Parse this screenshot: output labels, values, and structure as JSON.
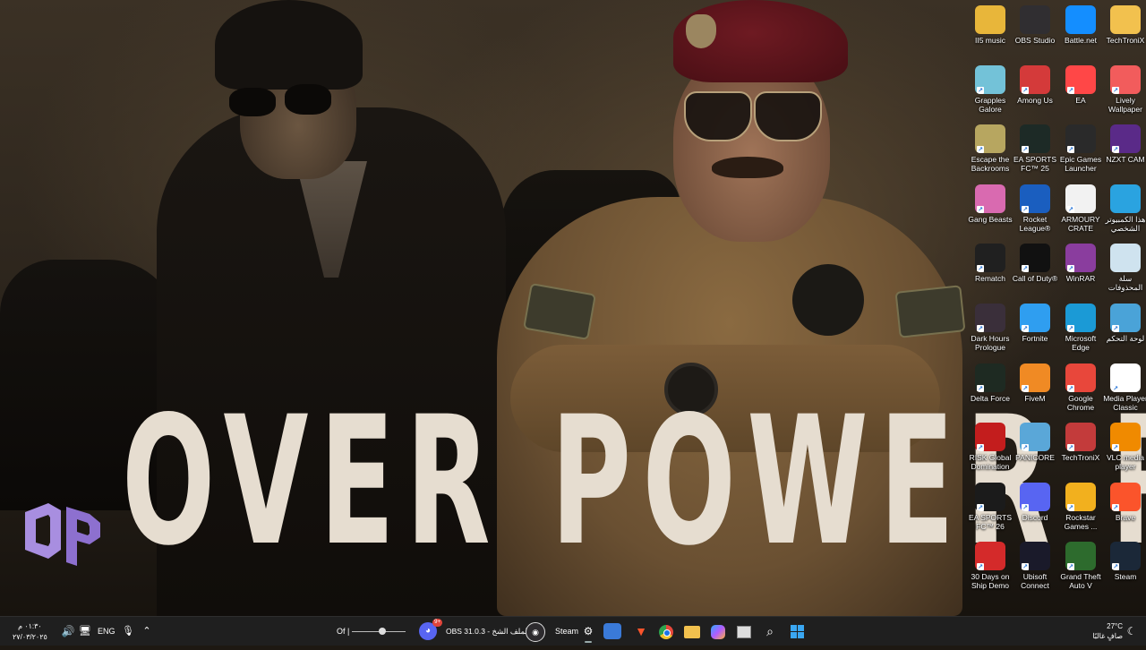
{
  "wallpaper": {
    "title": "OVER POWER RP",
    "logo": "OP-logo",
    "accent": "#9b7fd6"
  },
  "desktop_icons": [
    {
      "label": "II5 music",
      "icon": "folder-icon",
      "color": "#e8b63a"
    },
    {
      "label": "OBS Studio",
      "icon": "obs-icon",
      "color": "#302e31"
    },
    {
      "label": "Battle.net",
      "icon": "battlenet-icon",
      "color": "#148eff"
    },
    {
      "label": "TechTroniX",
      "icon": "folder-icon",
      "color": "#f2c14e"
    },
    {
      "label": "Grapples Galore",
      "icon": "grapples-icon",
      "color": "#73c2d8"
    },
    {
      "label": "Among Us",
      "icon": "among-us-icon",
      "color": "#d43a3a"
    },
    {
      "label": "EA",
      "icon": "ea-icon",
      "color": "#ff4747"
    },
    {
      "label": "Lively Wallpaper",
      "icon": "lively-icon",
      "color": "#f25c5c"
    },
    {
      "label": "Escape the Backrooms",
      "icon": "backrooms-icon",
      "color": "#b7a660"
    },
    {
      "label": "EA SPORTS FC™ 25",
      "icon": "fc25-icon",
      "color": "#1d2a26"
    },
    {
      "label": "Epic Games Launcher",
      "icon": "epic-icon",
      "color": "#2a2a2a"
    },
    {
      "label": "NZXT CAM",
      "icon": "nzxt-icon",
      "color": "#5a2a88"
    },
    {
      "label": "Gang Beasts",
      "icon": "gang-beasts-icon",
      "color": "#d96ab0"
    },
    {
      "label": "Rocket League®",
      "icon": "rocket-league-icon",
      "color": "#1a5ebf"
    },
    {
      "label": "ARMOURY CRATE",
      "icon": "file-icon",
      "color": "#f2f2f2"
    },
    {
      "label": "هذا الكمبيوتر الشخصي",
      "icon": "computer-icon",
      "color": "#2aa3e0"
    },
    {
      "label": "Rematch",
      "icon": "rematch-icon",
      "color": "#202020"
    },
    {
      "label": "Call of Duty®",
      "icon": "cod-icon",
      "color": "#111111"
    },
    {
      "label": "WinRAR",
      "icon": "winrar-icon",
      "color": "#8a3d9e"
    },
    {
      "label": "سلة المحذوفات",
      "icon": "recycle-bin-icon",
      "color": "#cfe3ef"
    },
    {
      "label": "Dark Hours Prologue",
      "icon": "dark-hours-icon",
      "color": "#3a2f3a"
    },
    {
      "label": "Fortnite",
      "icon": "fortnite-icon",
      "color": "#2f9ef0"
    },
    {
      "label": "Microsoft Edge",
      "icon": "edge-icon",
      "color": "#1b9ad6"
    },
    {
      "label": "لوحة التحكم",
      "icon": "control-panel-icon",
      "color": "#4aa3d8"
    },
    {
      "label": "Delta Force",
      "icon": "delta-force-icon",
      "color": "#1e2a22"
    },
    {
      "label": "FiveM",
      "icon": "fivem-icon",
      "color": "#f08a24"
    },
    {
      "label": "Google Chrome",
      "icon": "chrome-icon",
      "color": "#e8473b"
    },
    {
      "label": "Media Player Classic",
      "icon": "mpc-icon",
      "color": "#ffffff"
    },
    {
      "label": "RISK Global Domination",
      "icon": "risk-icon",
      "color": "#c31d1d"
    },
    {
      "label": "PANICORE",
      "icon": "panicore-icon",
      "color": "#5aa7d8"
    },
    {
      "label": "TechTroniX",
      "icon": "techtronix-icon",
      "color": "#c33b3b"
    },
    {
      "label": "VLC media player",
      "icon": "vlc-icon",
      "color": "#f08a00"
    },
    {
      "label": "EA SPORTS FC™ 26",
      "icon": "fc26-icon",
      "color": "#1b1b1b"
    },
    {
      "label": "Discord",
      "icon": "discord-icon",
      "color": "#5865f2"
    },
    {
      "label": "Rockstar Games ...",
      "icon": "rockstar-icon",
      "color": "#f2b01e"
    },
    {
      "label": "Brave",
      "icon": "brave-icon",
      "color": "#fb542b"
    },
    {
      "label": "30 Days on Ship Demo",
      "icon": "30days-icon",
      "color": "#d42a2a"
    },
    {
      "label": "Ubisoft Connect",
      "icon": "ubisoft-icon",
      "color": "#1a1a2a"
    },
    {
      "label": "Grand Theft Auto V",
      "icon": "gta-icon",
      "color": "#2d6b2d"
    },
    {
      "label": "Steam",
      "icon": "steam-icon",
      "color": "#1b2838"
    }
  ],
  "taskbar": {
    "clock_time": "٠١:٣٠ م",
    "clock_date": "٢٧/٠٣/٢٠٢٥",
    "language": "ENG",
    "media_label": "Of |",
    "obs_label": "OBS 31.0.3 - الملف الشخ",
    "steam_label": "Steam",
    "discord_badge": "9+",
    "weather_temp": "27°C",
    "weather_text": "صافٍ غالبًا"
  }
}
